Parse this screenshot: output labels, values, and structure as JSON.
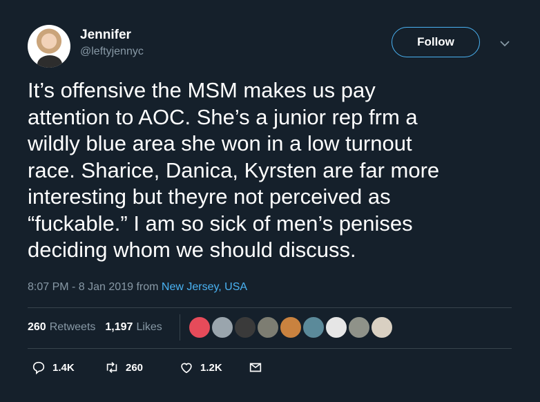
{
  "author": {
    "name": "Jennifer",
    "handle": "@leftyjennyc"
  },
  "follow_label": "Follow",
  "tweet": {
    "text": "It’s offensive the MSM makes us pay\nattention to AOC. She’s a junior rep frm a\nwildly blue area she won in a low turnout\nrace. Sharice, Danica, Kyrsten are far more\ninteresting but theyre not perceived as\n“fuckable.” I am so sick of men’s penises\ndeciding whom we should discuss.",
    "time": "8:07 PM - 8 Jan 2019",
    "from_label": "from",
    "location": "New Jersey, USA"
  },
  "stats": {
    "retweets_count": "260",
    "retweets_label": "Retweets",
    "likes_count": "1,197",
    "likes_label": "Likes"
  },
  "liker_avatars": [
    {
      "icon": "cartoon-avatar",
      "color": "#e64b5a"
    },
    {
      "icon": "default-avatar",
      "color": "#9aa5ad"
    },
    {
      "icon": "dog-avatar",
      "color": "#3a3a3a"
    },
    {
      "icon": "cat-avatar",
      "color": "#7d7d72"
    },
    {
      "icon": "woman-avatar",
      "color": "#c9823f"
    },
    {
      "icon": "palm-avatar",
      "color": "#5b8a9a"
    },
    {
      "icon": "sketch-avatar",
      "color": "#e6e6e6"
    },
    {
      "icon": "cat-avatar",
      "color": "#8f9289"
    },
    {
      "icon": "book-avatar",
      "color": "#d9d0c2"
    }
  ],
  "actions": {
    "replies": "1.4K",
    "retweets": "260",
    "likes": "1.2K"
  },
  "colors": {
    "background": "#15202b",
    "accent": "#4ab3f4",
    "muted": "#8899a6",
    "divider": "#38444d"
  }
}
